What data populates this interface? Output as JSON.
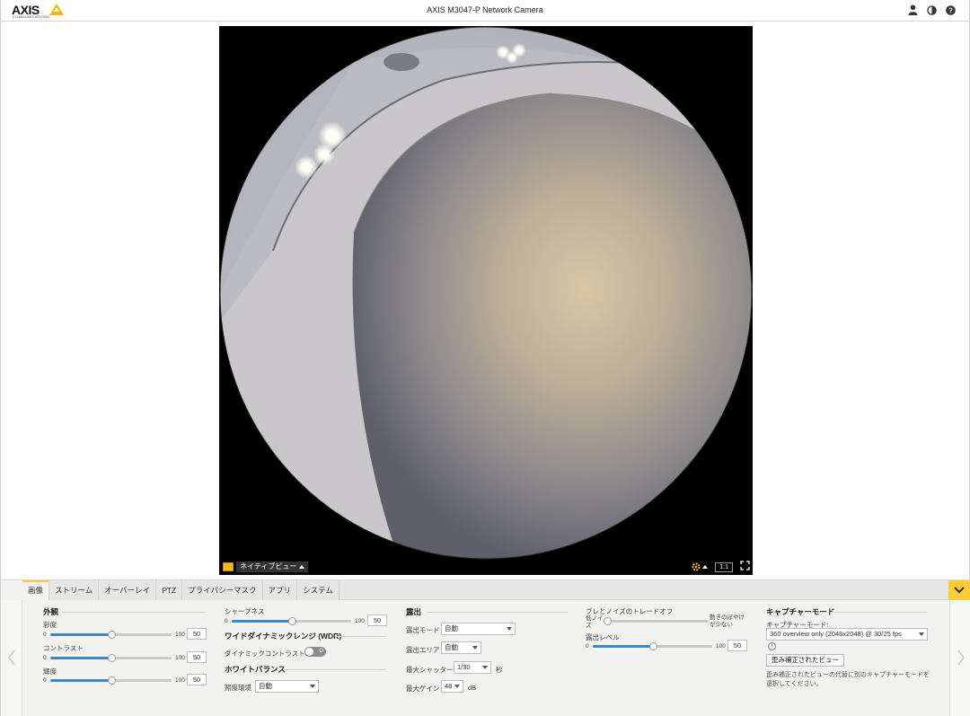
{
  "header": {
    "logo_text": "AXIS",
    "logo_sub": "COMMUNICATIONS",
    "title": "AXIS M3047-P Network Camera",
    "icons": [
      "user-icon",
      "contrast-icon",
      "help-icon"
    ]
  },
  "video": {
    "view_label": "ネイティブビュー",
    "scale_label": "1:1"
  },
  "tabs": [
    {
      "label": "画像",
      "active": true
    },
    {
      "label": "ストリーム"
    },
    {
      "label": "オーバーレイ"
    },
    {
      "label": "PTZ"
    },
    {
      "label": "プライバシーマスク"
    },
    {
      "label": "アプリ"
    },
    {
      "label": "システム"
    }
  ],
  "appearance": {
    "title": "外観",
    "saturation": {
      "label": "彩度",
      "min": "0",
      "max": "100",
      "value": "50",
      "fraction": 0.5
    },
    "contrast": {
      "label": "コントラスト",
      "min": "0",
      "max": "100",
      "value": "50",
      "fraction": 0.5
    },
    "brightness": {
      "label": "輝度",
      "min": "0",
      "max": "100",
      "value": "50",
      "fraction": 0.5
    }
  },
  "sharpness": {
    "label": "シャープネス",
    "min": "0",
    "max": "100",
    "value": "50",
    "fraction": 0.5
  },
  "wdr": {
    "title": "ワイドダイナミックレンジ (WDR)",
    "dynamic_contrast_label": "ダイナミックコントラスト",
    "toggle_text": "O"
  },
  "white_balance": {
    "title": "ホワイトバランス",
    "env_label": "照度環境",
    "env_value": "自動"
  },
  "exposure": {
    "title": "露出",
    "mode_label": "露出モード",
    "mode_value": "自動",
    "area_label": "露出エリア",
    "area_value": "自動",
    "shutter_label": "最大シャッター",
    "shutter_value": "1/30",
    "shutter_unit": "秒",
    "gain_label": "最大ゲイン",
    "gain_value": "48",
    "gain_unit": "dB"
  },
  "tradeoff": {
    "title": "ブレとノイズのトレードオフ",
    "low_noise": "低ノイズ",
    "low_blur": "動きのぼやけが少ない",
    "fraction": 0.02,
    "level_label": "露出レベル",
    "level_min": "0",
    "level_max": "100",
    "level_value": "50",
    "level_fraction": 0.5
  },
  "capture": {
    "title": "キャプチャーモード",
    "mode_label": "キャプチャーモード:",
    "mode_value": "360 overview only (2048x2048) @ 30/25 fps",
    "info": "i",
    "dewarp_button": "歪み補正されたビュー",
    "help": "歪み補正されたビューの代替に別のキャプチャーモードを選択してください。"
  },
  "colors": {
    "accent": "#ffcc33",
    "slider_fill": "#3b87c8"
  }
}
